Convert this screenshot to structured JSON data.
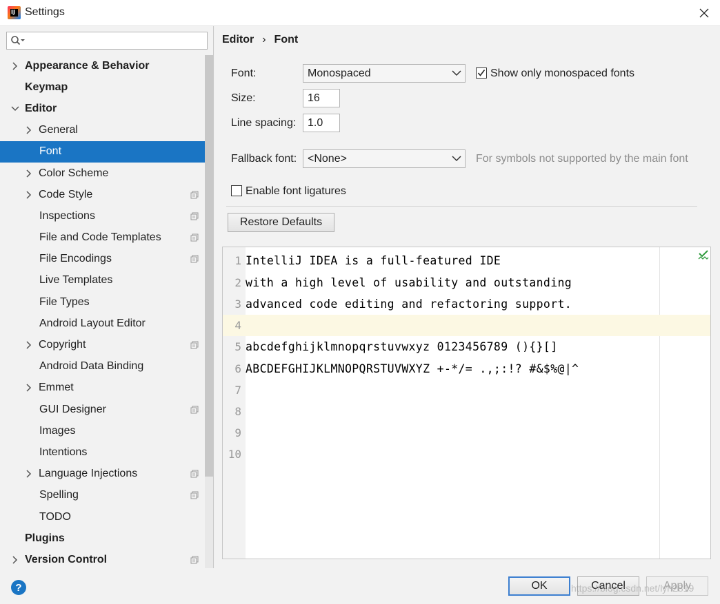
{
  "window": {
    "title": "Settings",
    "app_icon": "intellij-idea-icon"
  },
  "search": {
    "placeholder": ""
  },
  "sidebar": {
    "items": [
      {
        "label": "Appearance & Behavior",
        "bold": true,
        "arrow": "right"
      },
      {
        "label": "Keymap",
        "bold": true,
        "arrow": ""
      },
      {
        "label": "Editor",
        "bold": true,
        "arrow": "down"
      },
      {
        "label": "General",
        "bold": false,
        "arrow": "right"
      },
      {
        "label": "Font",
        "bold": false,
        "arrow": "",
        "selected": true
      },
      {
        "label": "Color Scheme",
        "bold": false,
        "arrow": "right"
      },
      {
        "label": "Code Style",
        "bold": false,
        "arrow": "right",
        "copy_icon": true
      },
      {
        "label": "Inspections",
        "bold": false,
        "arrow": "",
        "copy_icon": true
      },
      {
        "label": "File and Code Templates",
        "bold": false,
        "arrow": "",
        "copy_icon": true
      },
      {
        "label": "File Encodings",
        "bold": false,
        "arrow": "",
        "copy_icon": true
      },
      {
        "label": "Live Templates",
        "bold": false,
        "arrow": ""
      },
      {
        "label": "File Types",
        "bold": false,
        "arrow": ""
      },
      {
        "label": "Android Layout Editor",
        "bold": false,
        "arrow": ""
      },
      {
        "label": "Copyright",
        "bold": false,
        "arrow": "right",
        "copy_icon": true
      },
      {
        "label": "Android Data Binding",
        "bold": false,
        "arrow": ""
      },
      {
        "label": "Emmet",
        "bold": false,
        "arrow": "right"
      },
      {
        "label": "GUI Designer",
        "bold": false,
        "arrow": "",
        "copy_icon": true
      },
      {
        "label": "Images",
        "bold": false,
        "arrow": ""
      },
      {
        "label": "Intentions",
        "bold": false,
        "arrow": ""
      },
      {
        "label": "Language Injections",
        "bold": false,
        "arrow": "right",
        "copy_icon": true
      },
      {
        "label": "Spelling",
        "bold": false,
        "arrow": "",
        "copy_icon": true
      },
      {
        "label": "TODO",
        "bold": false,
        "arrow": ""
      },
      {
        "label": "Plugins",
        "bold": true,
        "arrow": ""
      },
      {
        "label": "Version Control",
        "bold": true,
        "arrow": "right",
        "copy_icon": true
      }
    ]
  },
  "breadcrumb": {
    "parent": "Editor",
    "separator": "›",
    "current": "Font"
  },
  "font": {
    "font_label": "Font:",
    "font_value": "Monospaced",
    "monospaced_only_label": "Show only monospaced fonts",
    "monospaced_only_checked": true,
    "size_label": "Size:",
    "size_value": "16",
    "line_spacing_label": "Line spacing:",
    "line_spacing_value": "1.0",
    "fallback_label": "Fallback font:",
    "fallback_value": "<None>",
    "fallback_hint": "For symbols not supported by the main font",
    "ligatures_label": "Enable font ligatures",
    "ligatures_checked": false,
    "restore_defaults": "Restore Defaults"
  },
  "preview": {
    "lines": [
      {
        "no": "1",
        "text": "IntelliJ IDEA is a full-featured IDE"
      },
      {
        "no": "2",
        "text": "with a high level of usability and outstanding"
      },
      {
        "no": "3",
        "text": "advanced code editing and refactoring support."
      },
      {
        "no": "4",
        "text": ""
      },
      {
        "no": "5",
        "text": "abcdefghijklmnopqrstuvwxyz 0123456789 (){}[]"
      },
      {
        "no": "6",
        "text": "ABCDEFGHIJKLMNOPQRSTUVWXYZ +-*/= .,;:!? #&$%@|^"
      },
      {
        "no": "7",
        "text": ""
      },
      {
        "no": "8",
        "text": ""
      },
      {
        "no": "9",
        "text": ""
      },
      {
        "no": "10",
        "text": ""
      }
    ],
    "current_line": 4
  },
  "buttons": {
    "ok": "OK",
    "cancel": "Cancel",
    "apply": "Apply"
  },
  "watermark": "https://blog.csdn.net/lyh2819",
  "colors": {
    "selection": "#1a75c4",
    "current_line": "#fcf8e3",
    "check": "#2e9a3c"
  }
}
